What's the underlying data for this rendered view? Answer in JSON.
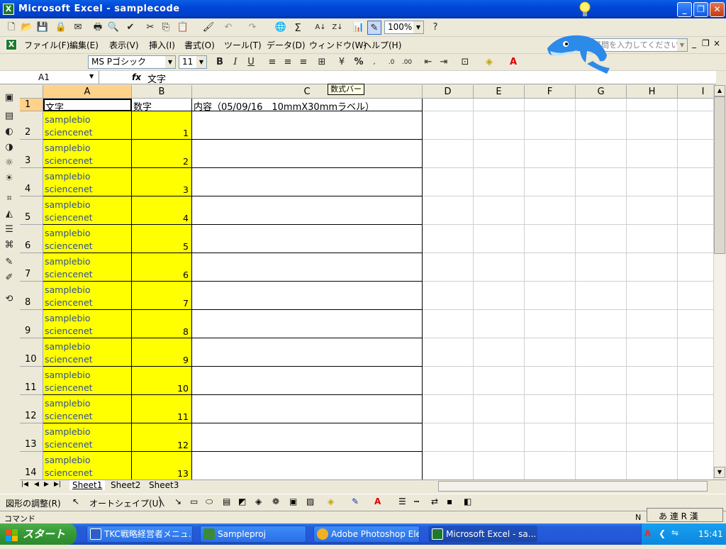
{
  "window": {
    "title": "Microsoft Excel - samplecode"
  },
  "menu": [
    "ファイル(F)",
    "編集(E)",
    "表示(V)",
    "挿入(I)",
    "書式(O)",
    "ツール(T)",
    "データ(D)",
    "ウィンドウ(W)",
    "ヘルプ(H)"
  ],
  "help_box": {
    "placeholder": "質問を入力してください"
  },
  "toolbar": {
    "zoom": "100%",
    "font": "MS Pゴシック",
    "size": "11"
  },
  "formula_bar": {
    "name_box": "A1",
    "fx": "fx",
    "content": "文字",
    "tooltip": "数式バー"
  },
  "columns": [
    "A",
    "B",
    "C",
    "D",
    "E",
    "F",
    "G",
    "H",
    "I"
  ],
  "header_row": {
    "row": "1",
    "a": "文字",
    "b": "数字",
    "c": "内容（05/09/16　10mmX30mmラベル）"
  },
  "rows": [
    {
      "row": "2",
      "line1": "samplebio",
      "line2": "sciencenet",
      "num": "1"
    },
    {
      "row": "3",
      "line1": "samplebio",
      "line2": "sciencenet",
      "num": "2"
    },
    {
      "row": "4",
      "line1": "samplebio",
      "line2": "sciencenet",
      "num": "3"
    },
    {
      "row": "5",
      "line1": "samplebio",
      "line2": "sciencenet",
      "num": "4"
    },
    {
      "row": "6",
      "line1": "samplebio",
      "line2": "sciencenet",
      "num": "5"
    },
    {
      "row": "7",
      "line1": "samplebio",
      "line2": "sciencenet",
      "num": "6"
    },
    {
      "row": "8",
      "line1": "samplebio",
      "line2": "sciencenet",
      "num": "7"
    },
    {
      "row": "9",
      "line1": "samplebio",
      "line2": "sciencenet",
      "num": "8"
    },
    {
      "row": "10",
      "line1": "samplebio",
      "line2": "sciencenet",
      "num": "9"
    },
    {
      "row": "11",
      "line1": "samplebio",
      "line2": "sciencenet",
      "num": "10"
    },
    {
      "row": "12",
      "line1": "samplebio",
      "line2": "sciencenet",
      "num": "11"
    },
    {
      "row": "13",
      "line1": "samplebio",
      "line2": "sciencenet",
      "num": "12"
    },
    {
      "row": "14",
      "line1": "samplebio",
      "line2": "sciencenet",
      "num": "13"
    }
  ],
  "sheets": [
    "Sheet1",
    "Sheet2",
    "Sheet3"
  ],
  "drawbar": {
    "adjust": "図形の調整(R)",
    "autoshape": "オートシェイプ(U)"
  },
  "status": {
    "mode": "コマンド",
    "num": "N"
  },
  "ime": {
    "label": "あ 連 R 漢"
  },
  "taskbar": {
    "start": "スタート",
    "tasks": [
      "TKC戦略経営者メニュ...",
      "Sampleproj",
      "Adobe Photoshop Ele...",
      "Microsoft Excel - sa..."
    ],
    "clock": "15:41"
  },
  "colors": {
    "selection_fill": "#FFFF00",
    "title_blue": "#0045D4",
    "start_green": "#379B37"
  }
}
